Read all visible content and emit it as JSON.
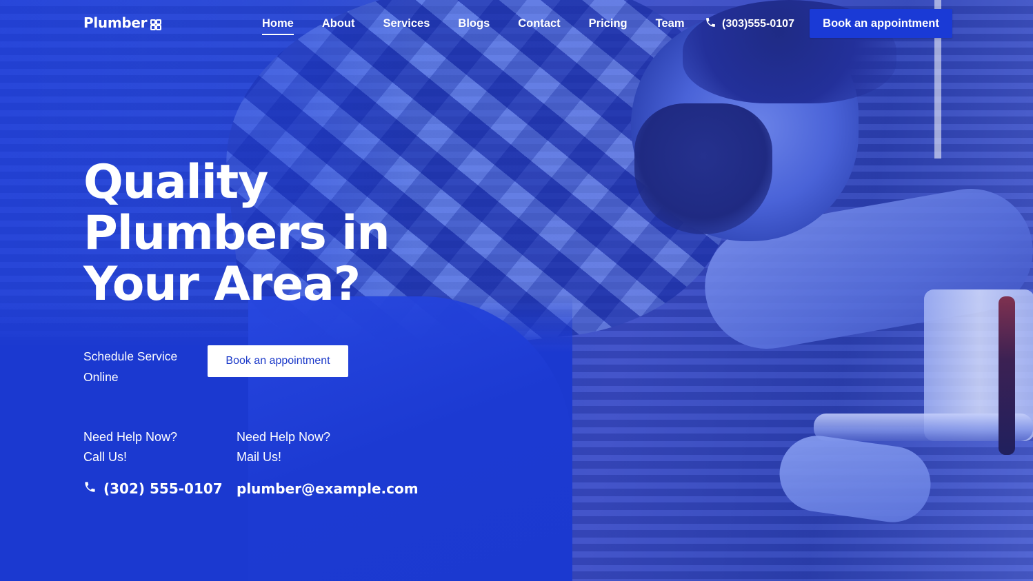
{
  "brand": {
    "name": "Plumber",
    "logo_icon": "grid-square-icon"
  },
  "nav": {
    "items": [
      {
        "label": "Home",
        "active": true
      },
      {
        "label": "About",
        "active": false
      },
      {
        "label": "Services",
        "active": false
      },
      {
        "label": "Blogs",
        "active": false
      },
      {
        "label": "Contact",
        "active": false
      },
      {
        "label": "Pricing",
        "active": false
      },
      {
        "label": "Team",
        "active": false
      }
    ],
    "phone": "(303)555-0107",
    "phone_icon": "phone-icon",
    "cta_label": "Book an appointment"
  },
  "hero": {
    "headline_lines": [
      "Quality",
      "Plumbers in",
      "Your Area?"
    ],
    "schedule_text": "Schedule Service Online",
    "cta_label": "Book an appointment",
    "call": {
      "label_line1": "Need Help Now?",
      "label_line2": "Call Us!",
      "value": "(302) 555-0107",
      "icon": "phone-icon"
    },
    "mail": {
      "label_line1": "Need Help Now?",
      "label_line2": "Mail Us!",
      "value": "plumber@example.com"
    }
  },
  "colors": {
    "primary": "#1a3ad6",
    "overlay": "#1b39d0",
    "text": "#ffffff"
  }
}
